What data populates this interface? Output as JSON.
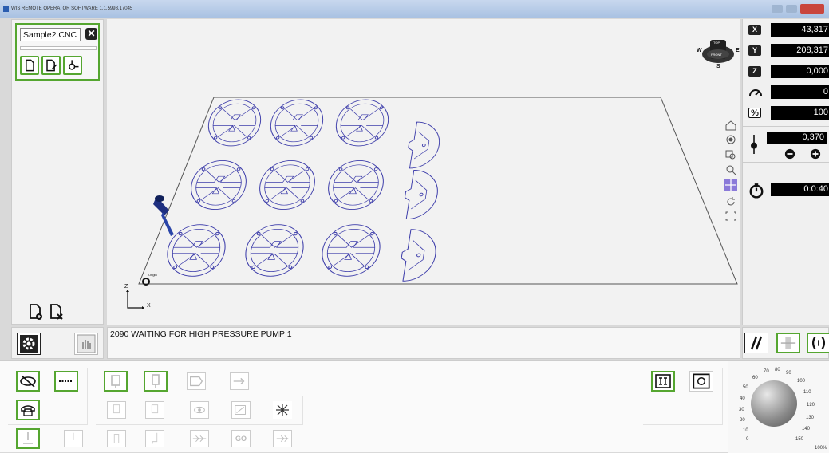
{
  "window": {
    "title": "WIS REMOTE OPERATOR SOFTWARE 1.1.5998.17045"
  },
  "file": {
    "name": "Sample2.CNC",
    "close_label": "✕",
    "progress": 0
  },
  "viewport": {
    "compass": {
      "n": "TOP",
      "w": "W",
      "e": "E",
      "s": "S",
      "center": "FRONT"
    },
    "axis": {
      "z": "Z",
      "x": "X"
    },
    "origin_label": "Origin",
    "tools": [
      "home-icon",
      "view-orbit-icon",
      "zoom-window-icon",
      "zoom-icon",
      "pan-icon",
      "rotate-icon",
      "fit-icon"
    ]
  },
  "dro": {
    "x": {
      "label": "X",
      "value": "43,317"
    },
    "y": {
      "label": "Y",
      "value": "208,317"
    },
    "z": {
      "label": "Z",
      "value": "0,000"
    },
    "speed": {
      "value": "0"
    },
    "override": {
      "label": "%",
      "value": "100"
    },
    "thickness": {
      "value": "0,370"
    },
    "timer": {
      "value": "0:0:40"
    }
  },
  "status": {
    "message": "2090 WAITING FOR HIGH PRESSURE PUMP 1"
  },
  "bottom": {
    "go_label": "GO"
  },
  "speed_dial": {
    "ticks": [
      "0",
      "10",
      "20",
      "30",
      "40",
      "50",
      "60",
      "70",
      "80",
      "90",
      "100",
      "110",
      "120",
      "130",
      "140",
      "150"
    ],
    "percent": "100%"
  },
  "colors": {
    "accent_green": "#55a630",
    "part_outline": "#3d3daa"
  }
}
